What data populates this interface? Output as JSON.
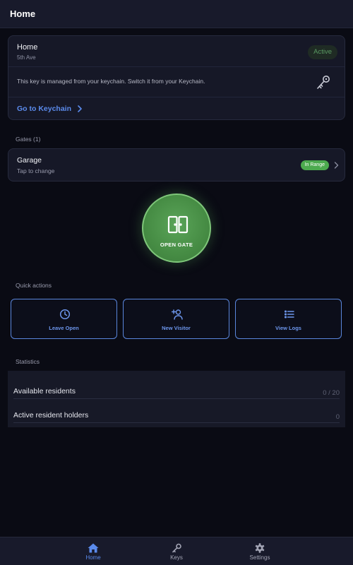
{
  "header": {
    "title": "Home"
  },
  "home_card": {
    "name": "Home",
    "address": "5th Ave",
    "status": "Active",
    "message": "This key is managed from your keychain. Switch it from your Keychain.",
    "keychain_link": "Go to Keychain",
    "icon": "key-icon"
  },
  "gates": {
    "section_label": "Gates (1)",
    "items": [
      {
        "name": "Garage",
        "subtitle": "Tap to change",
        "badge": "In Range"
      }
    ]
  },
  "open_gate": {
    "label": "OPEN GATE",
    "icon": "gate-icon"
  },
  "quick_actions": {
    "section_label": "Quick actions",
    "items": [
      {
        "label": "Leave Open",
        "icon": "clock-icon"
      },
      {
        "label": "New Visitor",
        "icon": "add-person-icon"
      },
      {
        "label": "View Logs",
        "icon": "list-icon"
      }
    ]
  },
  "statistics": {
    "section_label": "Statistics",
    "rows": [
      {
        "label": "Available residents",
        "value": "0 / 20"
      },
      {
        "label": "Active resident holders",
        "value": "0"
      }
    ]
  },
  "tabbar": {
    "items": [
      {
        "label": "Home",
        "icon": "home-icon",
        "active": true
      },
      {
        "label": "Keys",
        "icon": "key-icon",
        "active": false
      },
      {
        "label": "Settings",
        "icon": "gear-icon",
        "active": false
      }
    ]
  },
  "colors": {
    "accent": "#5b8bec",
    "success": "#4caa4e",
    "background": "#0a0b14",
    "card": "#161827"
  }
}
